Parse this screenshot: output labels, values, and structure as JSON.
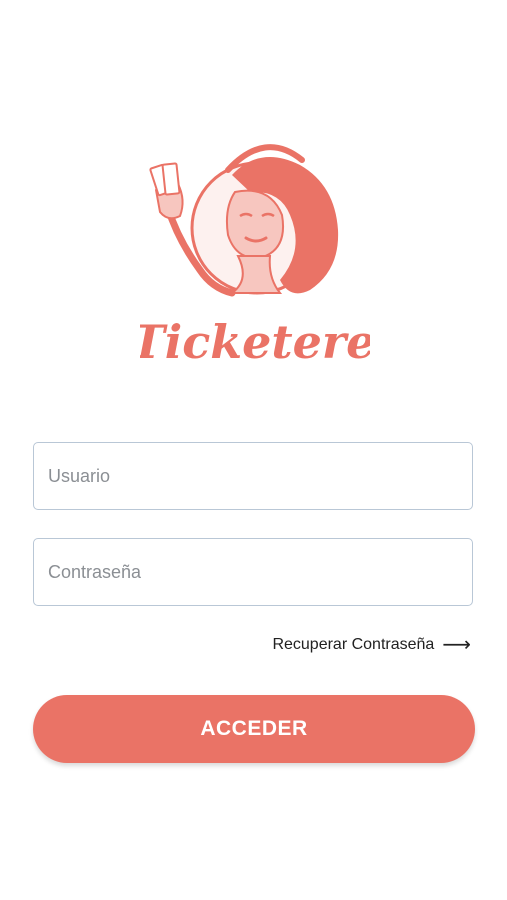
{
  "brand": {
    "name": "Ticketere",
    "accent_color": "#ea7366",
    "logo_icon": "woman-holding-tickets-illustration"
  },
  "form": {
    "username_placeholder": "Usuario",
    "password_placeholder": "Contraseña",
    "recover_label": "Recuperar Contraseña",
    "recover_icon": "arrow-right-icon",
    "submit_label": "ACCEDER"
  }
}
